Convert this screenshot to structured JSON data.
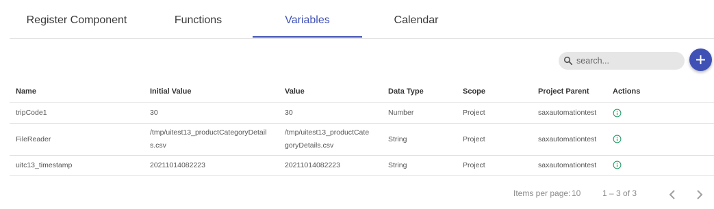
{
  "tabs": [
    {
      "label": "Register Component",
      "active": false
    },
    {
      "label": "Functions",
      "active": false
    },
    {
      "label": "Variables",
      "active": true
    },
    {
      "label": "Calendar",
      "active": false
    }
  ],
  "search": {
    "placeholder": "search...",
    "icon": "search-icon"
  },
  "add_button": {
    "icon": "plus-icon"
  },
  "table": {
    "headers": [
      "Name",
      "Initial Value",
      "Value",
      "Data Type",
      "Scope",
      "Project Parent",
      "Actions"
    ],
    "rows": [
      {
        "name": "tripCode1",
        "initial_value_1": "30",
        "initial_value_2": "",
        "value_1": "30",
        "value_2": "",
        "data_type": "Number",
        "scope": "Project",
        "project_parent": "saxautomationtest",
        "action_icon": "info-icon"
      },
      {
        "name": "FileReader",
        "initial_value_1": "/tmp/uitest13_productCategoryDetail",
        "initial_value_2": "s.csv",
        "value_1": "/tmp/uitest13_productCate",
        "value_2": "goryDetails.csv",
        "data_type": "String",
        "scope": "Project",
        "project_parent": "saxautomationtest",
        "action_icon": "info-icon"
      },
      {
        "name": "uitc13_timestamp",
        "initial_value_1": "20211014082223",
        "initial_value_2": "",
        "value_1": "20211014082223",
        "value_2": "",
        "data_type": "String",
        "scope": "Project",
        "project_parent": "saxautomationtest",
        "action_icon": "info-icon"
      }
    ]
  },
  "paginator": {
    "items_per_page_label": "Items per page:",
    "items_per_page_value": "10",
    "range_label": "1 – 3 of 3",
    "prev_icon": "chevron-left-icon",
    "next_icon": "chevron-right-icon"
  },
  "colors": {
    "accent": "#3f51b5",
    "info_icon": "#2e9e6e",
    "search_bg": "#e6e6e6"
  }
}
